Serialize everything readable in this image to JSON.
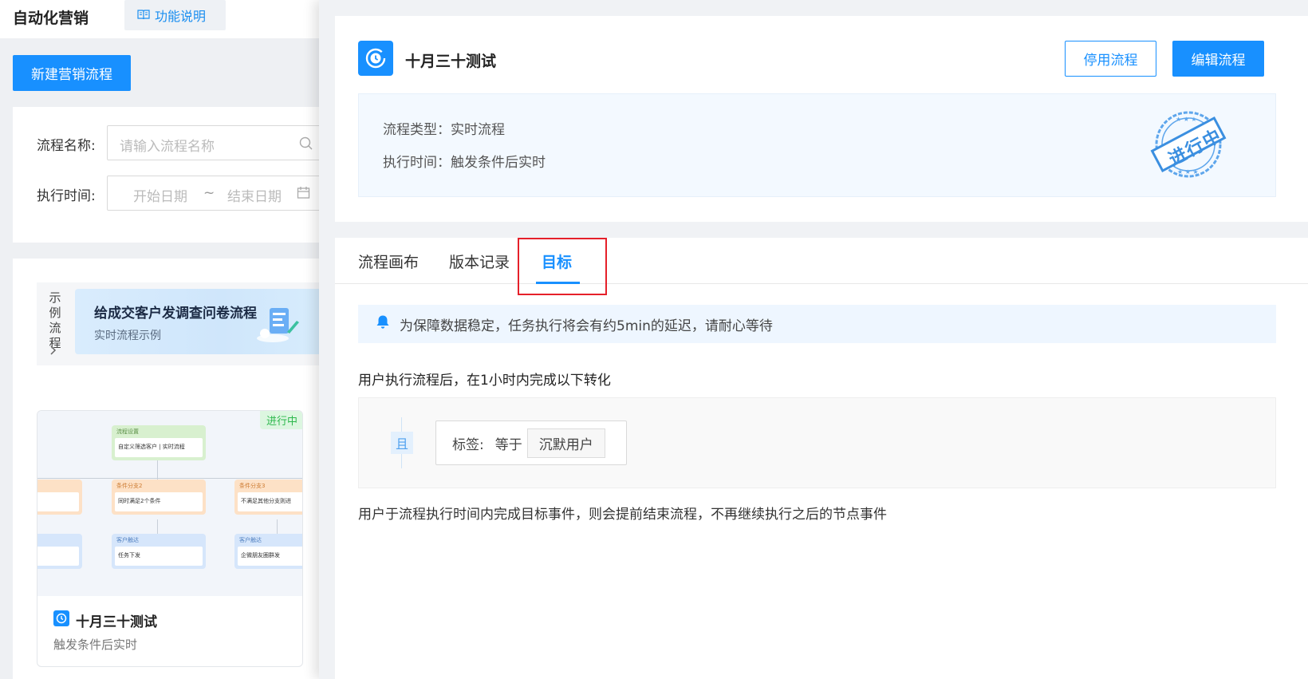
{
  "app": {
    "title": "自动化营销",
    "doc_link": "功能说明"
  },
  "toolbar": {
    "new_flow": "新建营销流程"
  },
  "filters": {
    "name_label": "流程名称:",
    "name_placeholder": "请输入流程名称",
    "time_label": "执行时间:",
    "start_placeholder": "开始日期",
    "separator": "~",
    "end_placeholder": "结束日期"
  },
  "example": {
    "side_label": [
      "示",
      "例",
      "流",
      "程"
    ],
    "title": "给成交客户发调查问卷流程",
    "subtitle": "实时流程示例"
  },
  "flow_card": {
    "badge": "进行中",
    "name": "十月三十测试",
    "subtitle": "触发条件后实时",
    "thumb": {
      "n1_head": "流程设置",
      "n1_body": "自定义筛选客户 | 实时流程",
      "n2_head": "条件分支2",
      "n2_body": "同时满足2个条件",
      "n3_head": "条件分支3",
      "n3_body": "不满足其他分支则进",
      "n4_head": "客户触达",
      "n4_body": "任务下发",
      "n5_head": "客户触达",
      "n5_body": "企微朋友圈群发"
    }
  },
  "drawer": {
    "flow_name": "十月三十测试",
    "disable_button": "停用流程",
    "edit_button": "编辑流程",
    "type_line": "流程类型：实时流程",
    "exec_line": "执行时间：触发条件后实时",
    "stamp_text": "进行中",
    "tabs": [
      {
        "label": "流程画布"
      },
      {
        "label": "版本记录"
      },
      {
        "label": "目标"
      }
    ],
    "notice": "为保障数据稳定，任务执行将会有约5min的延迟，请耐心等待",
    "goal_title": "用户执行流程后，在1小时内完成以下转化",
    "and_label": "且",
    "condition": {
      "label": "标签:",
      "op": "等于",
      "value": "沉默用户"
    },
    "footer_note": "用户于流程执行时间内完成目标事件，则会提前结束流程，不再继续执行之后的节点事件"
  },
  "colors": {
    "primary": "#1890ff",
    "highlight": "#e5202a",
    "status_green": "#2db84d"
  }
}
